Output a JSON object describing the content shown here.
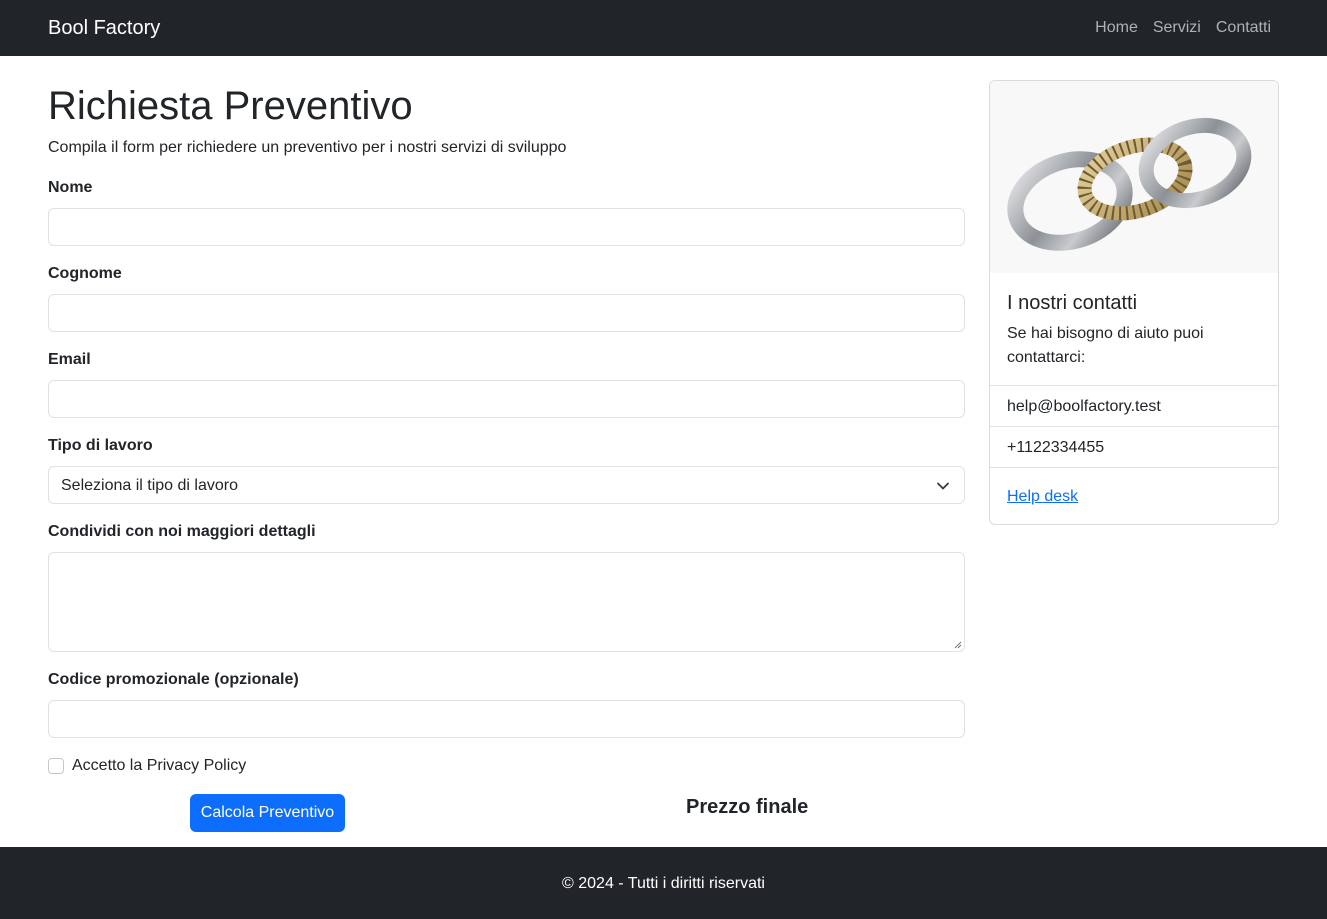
{
  "navbar": {
    "brand": "Bool Factory",
    "links": [
      "Home",
      "Servizi",
      "Contatti"
    ]
  },
  "main": {
    "title": "Richiesta Preventivo",
    "subtitle": "Compila il form per richiedere un preventivo per i nostri servizi di sviluppo",
    "form": {
      "name_label": "Nome",
      "name_value": "",
      "surname_label": "Cognome",
      "surname_value": "",
      "email_label": "Email",
      "email_value": "",
      "job_type_label": "Tipo di lavoro",
      "job_type_selected": "Seleziona il tipo di lavoro",
      "details_label": "Condividi con noi maggiori dettagli",
      "details_value": "",
      "promo_label": "Codice promozionale (opzionale)",
      "promo_value": "",
      "privacy_label": "Accetto la Privacy Policy",
      "privacy_checked": false,
      "submit_label": "Calcola Preventivo"
    },
    "final_price_label": "Prezzo finale"
  },
  "card": {
    "title": "I nostri contatti",
    "text": "Se hai bisogno di aiuto puoi contattarci:",
    "email": "help@boolfactory.test",
    "phone": "+1122334455",
    "link_label": "Help desk"
  },
  "footer": {
    "text": "© 2024 - Tutti i diritti riservati"
  },
  "colors": {
    "navbar_bg": "#212529",
    "primary": "#0d6efd",
    "nav_link": "#aeb1b5"
  }
}
